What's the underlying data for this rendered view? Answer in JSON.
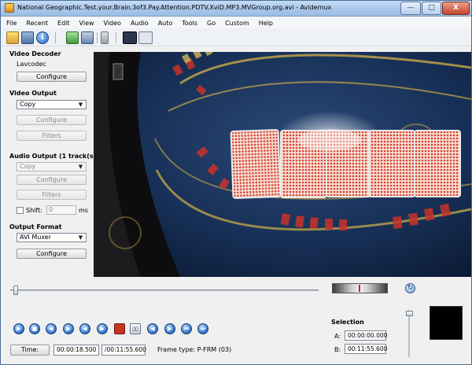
{
  "window": {
    "title": "National Geographic.Test.your.Brain.3of3.Pay.Attention.PDTV.XviD.MP3.MVGroup.org.avi - Avidemux",
    "minimize": "—",
    "maximize": "□",
    "close": "X"
  },
  "menu": [
    "File",
    "Recent",
    "Edit",
    "View",
    "Video",
    "Audio",
    "Auto",
    "Tools",
    "Go",
    "Custom",
    "Help"
  ],
  "left_panel": {
    "video_decoder": {
      "title": "Video Decoder",
      "codec": "Lavcodec",
      "configure": "Configure"
    },
    "video_output": {
      "title": "Video Output",
      "selected": "Copy",
      "configure": "Configure",
      "filters": "Filters"
    },
    "audio_output": {
      "title": "Audio Output (1 track(s))",
      "selected": "Copy",
      "configure": "Configure",
      "filters": "Filters",
      "shift_label": "Shift:",
      "shift_value": "0",
      "shift_unit": "ms"
    },
    "output_format": {
      "title": "Output Format",
      "selected": "AVI Muxer",
      "configure": "Configure"
    }
  },
  "scrubber": {
    "position_fraction": 0.01
  },
  "transport": {
    "buttons": [
      {
        "name": "play-icon",
        "glyph": "▶"
      },
      {
        "name": "stop-icon",
        "glyph": "■"
      },
      {
        "name": "previous-frame-icon",
        "glyph": "◀"
      },
      {
        "name": "next-frame-icon",
        "glyph": "▶"
      },
      {
        "name": "previous-keyframe-icon",
        "glyph": "◀"
      },
      {
        "name": "next-keyframe-icon",
        "glyph": "▶"
      },
      {
        "name": "set-marker-a-icon",
        "glyph": ""
      },
      {
        "name": "set-marker-b-icon",
        "glyph": "▯▯"
      },
      {
        "name": "previous-black-frame-icon",
        "glyph": "◀"
      },
      {
        "name": "next-black-frame-icon",
        "glyph": "▶"
      },
      {
        "name": "go-first-frame-icon",
        "glyph": "⏮"
      },
      {
        "name": "go-last-frame-icon",
        "glyph": "⏭"
      }
    ]
  },
  "selection": {
    "title": "Selection",
    "a_label": "A:",
    "a_value": "00:00:00.000",
    "b_label": "B:",
    "b_value": "00:11:55.600"
  },
  "status": {
    "time_button": "Time:",
    "current_time": "00:00:18.500",
    "total_time": "/00:11:55.600",
    "frame_type": "Frame type: P-FRM (03)"
  }
}
